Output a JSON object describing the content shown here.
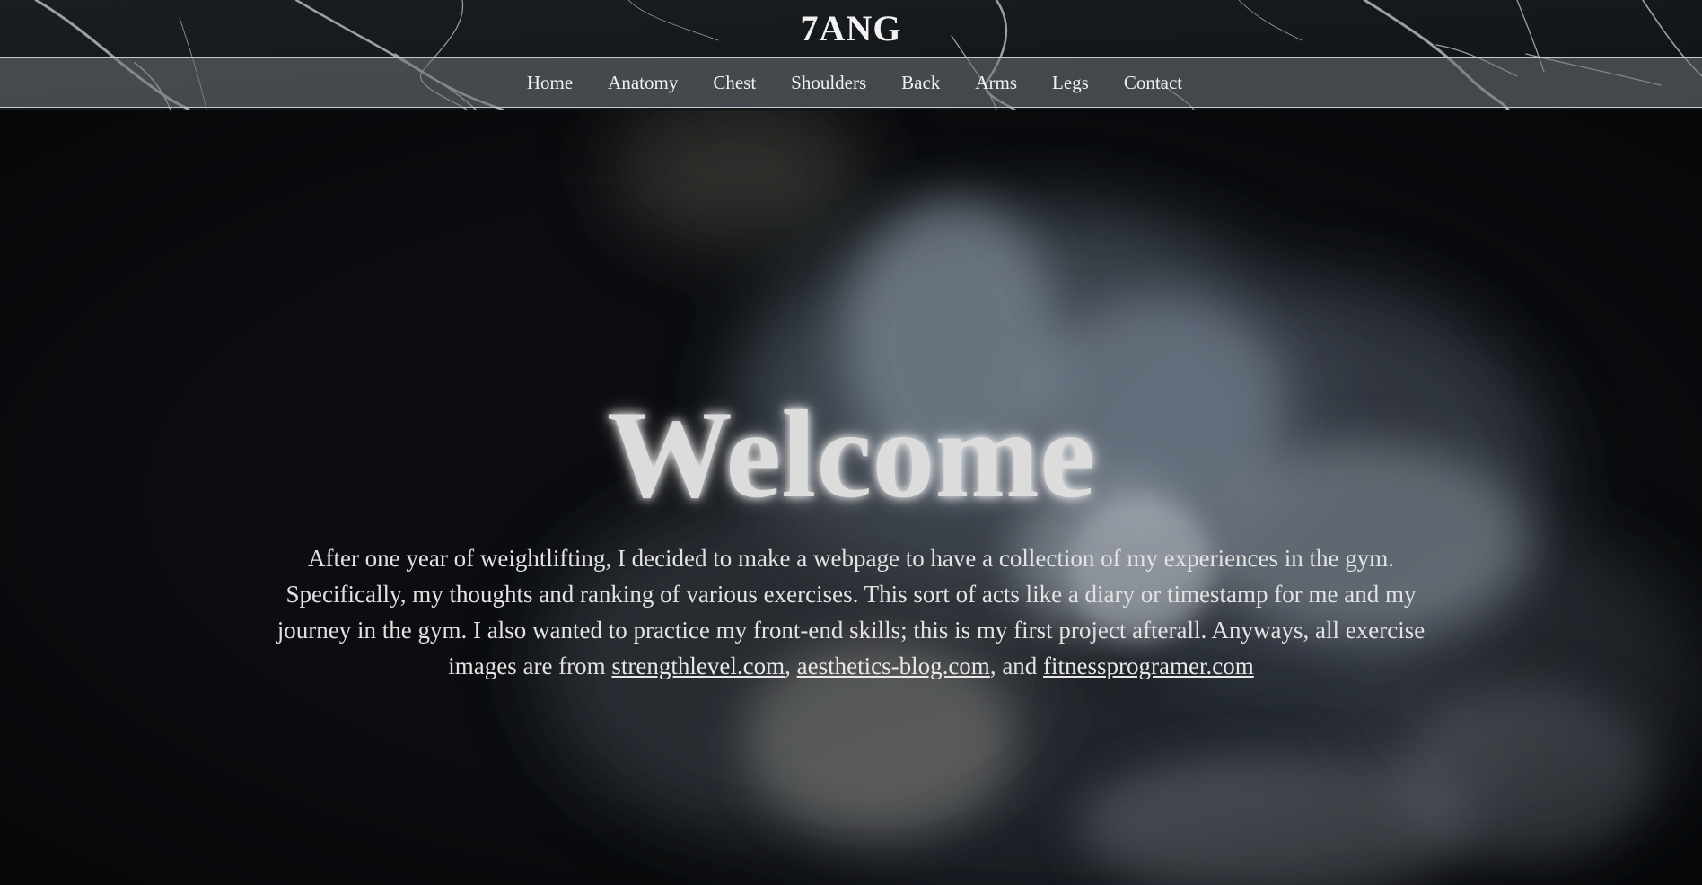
{
  "site": {
    "brand": "7ANG"
  },
  "nav": {
    "items": [
      {
        "label": "Home"
      },
      {
        "label": "Anatomy"
      },
      {
        "label": "Chest"
      },
      {
        "label": "Shoulders"
      },
      {
        "label": "Back"
      },
      {
        "label": "Arms"
      },
      {
        "label": "Legs"
      },
      {
        "label": "Contact"
      }
    ]
  },
  "hero": {
    "heading": "Welcome",
    "intro_text": "After one year of weightlifting, I decided to make a webpage to have a collection of my experiences in the gym. Specifically, my thoughts and ranking of various exercises. This sort of acts like a diary or timestamp for me and my journey in the gym. I also wanted to practice my front-end skills; this is my first project afterall. Anyways, all exercise images are from",
    "sep_1": ",",
    "sep_2": ", and",
    "links": [
      {
        "label": "strengthlevel.com"
      },
      {
        "label": "aesthetics-blog.com"
      },
      {
        "label": "fitnessprogramer.com"
      }
    ]
  },
  "colors": {
    "background": "#0b0d10",
    "navbar": "#6e7276",
    "text": "#e6e6e6",
    "heading": "#dcdcdc"
  }
}
